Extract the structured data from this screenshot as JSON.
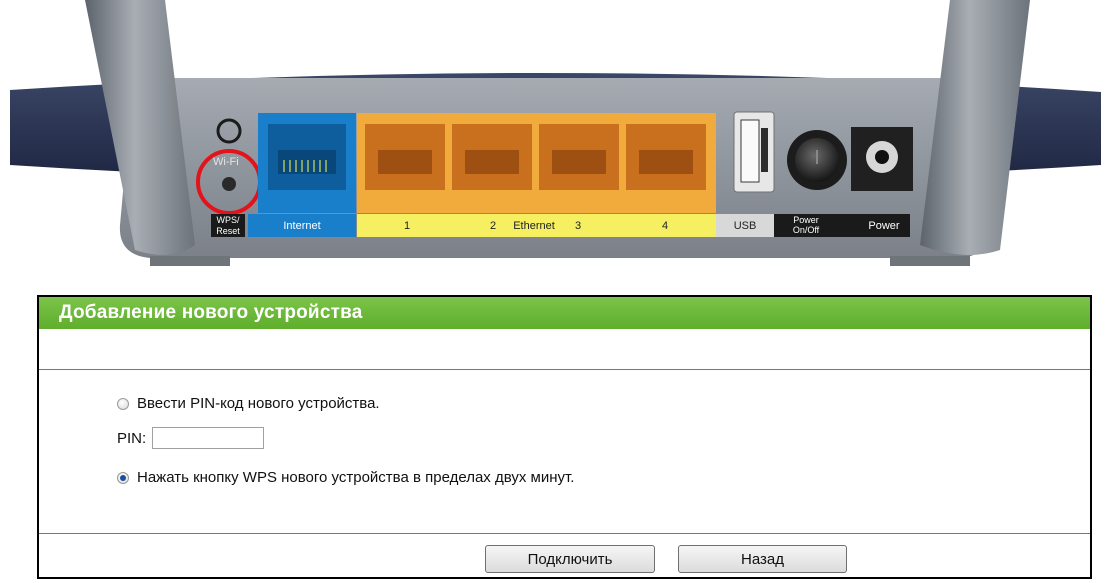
{
  "router": {
    "wifi_label": "Wi-Fi",
    "wps_reset_label": "WPS/\nReset",
    "internet_label": "Internet",
    "lan_numbers": [
      "1",
      "2",
      "3",
      "4"
    ],
    "ethernet_label": "Ethernet",
    "usb_label": "USB",
    "power_onoff_label": "Power\nOn/Off",
    "power_label": "Power",
    "colors": {
      "internet_blue": "#1a7fcb",
      "lan_orange": "#f1ab3c",
      "label_yellow": "#f7ef62",
      "highlight_red": "#e3131b"
    }
  },
  "dialog": {
    "title": "Добавление нового устройства",
    "option_pin_label": "Ввести PIN-код нового устройства.",
    "pin_label": "PIN:",
    "pin_value": "",
    "option_wps_label": "Нажать кнопку WPS нового устройства в пределах двух минут.",
    "selected_option": "wps",
    "connect_button": "Подключить",
    "back_button": "Назад"
  }
}
